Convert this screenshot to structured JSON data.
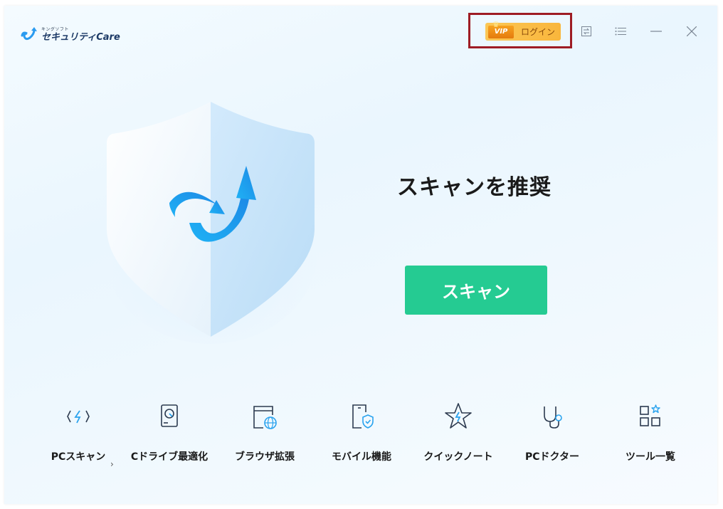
{
  "app": {
    "logo_small": "キングソフト",
    "logo_main": "セキュリティCare"
  },
  "titlebar": {
    "vip_badge": "VIP",
    "login_label": "ログイン",
    "icons": [
      "convert-icon",
      "menu-icon",
      "minimize-icon",
      "close-icon"
    ]
  },
  "main": {
    "headline": "スキャンを推奨",
    "scan_button": "スキャン"
  },
  "tools": [
    {
      "label": "PCスキャン",
      "icon": "lightning-icon"
    },
    {
      "label": "Cドライブ最適化",
      "icon": "drive-icon"
    },
    {
      "label": "ブラウザ拡張",
      "icon": "browser-globe-icon"
    },
    {
      "label": "モバイル機能",
      "icon": "mobile-shield-icon"
    },
    {
      "label": "クイックノート",
      "icon": "star-icon"
    },
    {
      "label": "PCドクター",
      "icon": "stethoscope-icon"
    },
    {
      "label": "ツール一覧",
      "icon": "tools-grid-icon"
    }
  ],
  "separator_glyph": "›",
  "colors": {
    "accent": "#25cb92",
    "brand": "#2a9bf0",
    "vip": "#fbc755",
    "highlight_border": "#9e1c24"
  }
}
